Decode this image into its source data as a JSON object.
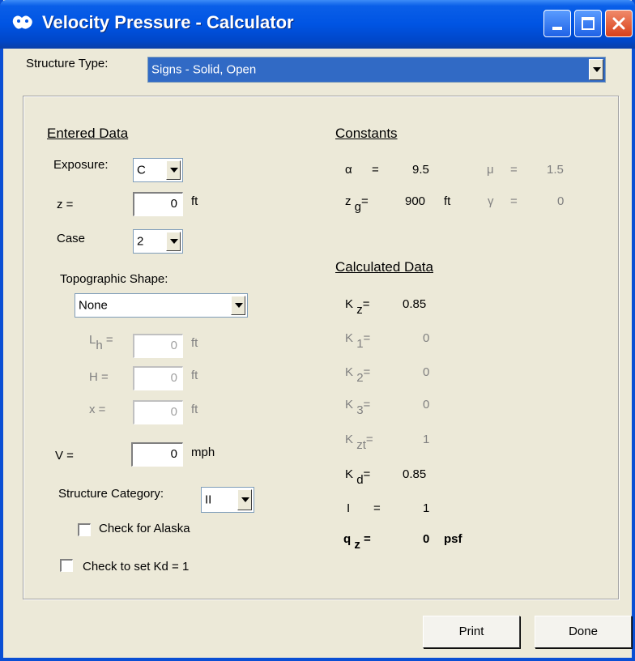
{
  "window": {
    "title": "Velocity Pressure - Calculator",
    "icon": "app-icon",
    "controls": [
      "minimize-icon",
      "maximize-icon",
      "close-icon"
    ]
  },
  "structure_type": {
    "label": "Structure Type:",
    "value": "Signs - Solid, Open"
  },
  "entered": {
    "heading": "Entered Data",
    "exposure": {
      "label": "Exposure:",
      "value": "C"
    },
    "z": {
      "label": "z  =",
      "value": "0",
      "unit": "ft"
    },
    "case": {
      "label": "Case",
      "value": "2"
    },
    "topo": {
      "label": "Topographic Shape:",
      "value": "None"
    },
    "lh": {
      "label_main": "L",
      "label_sub": "h",
      "eq": "=",
      "value": "0",
      "unit": "ft"
    },
    "h": {
      "label": "H   =",
      "value": "0",
      "unit": "ft"
    },
    "x": {
      "label": "x    =",
      "value": "0",
      "unit": "ft"
    },
    "v": {
      "label": "V  =",
      "value": "0",
      "unit": "mph"
    },
    "category": {
      "label": "Structure Category:",
      "value": "II"
    },
    "alaska": {
      "label": "Check for Alaska",
      "checked": false
    },
    "kd1": {
      "label": "Check to set  Kd = 1",
      "checked": false
    }
  },
  "constants": {
    "heading": "Constants",
    "alpha": {
      "symbol": "α",
      "eq": "=",
      "value": "9.5"
    },
    "mu": {
      "symbol": "μ",
      "eq": "=",
      "value": "1.5"
    },
    "zg": {
      "main": "z",
      "sub": "g",
      "eq": "=",
      "value": "900",
      "unit": "ft"
    },
    "gamma": {
      "symbol": "γ",
      "eq": "=",
      "value": "0"
    }
  },
  "calculated": {
    "heading": "Calculated Data",
    "kz": {
      "main": "K",
      "sub": "z",
      "eq": "=",
      "value": "0.85"
    },
    "k1": {
      "main": "K",
      "sub": "1",
      "eq": "=",
      "value": "0"
    },
    "k2": {
      "main": "K",
      "sub": "2",
      "eq": "=",
      "value": "0"
    },
    "k3": {
      "main": "K",
      "sub": "3",
      "eq": "=",
      "value": "0"
    },
    "kzt": {
      "main": "K",
      "sub": "zt",
      "eq": "=",
      "value": "1"
    },
    "kd": {
      "main": "K",
      "sub": "d",
      "eq": "=",
      "value": "0.85"
    },
    "i": {
      "label": "I",
      "eq": "=",
      "value": "1"
    },
    "qz": {
      "main": "q",
      "sub": "z",
      "eq": "=",
      "value": "0",
      "unit": "psf"
    }
  },
  "buttons": {
    "print": "Print",
    "done": "Done"
  }
}
